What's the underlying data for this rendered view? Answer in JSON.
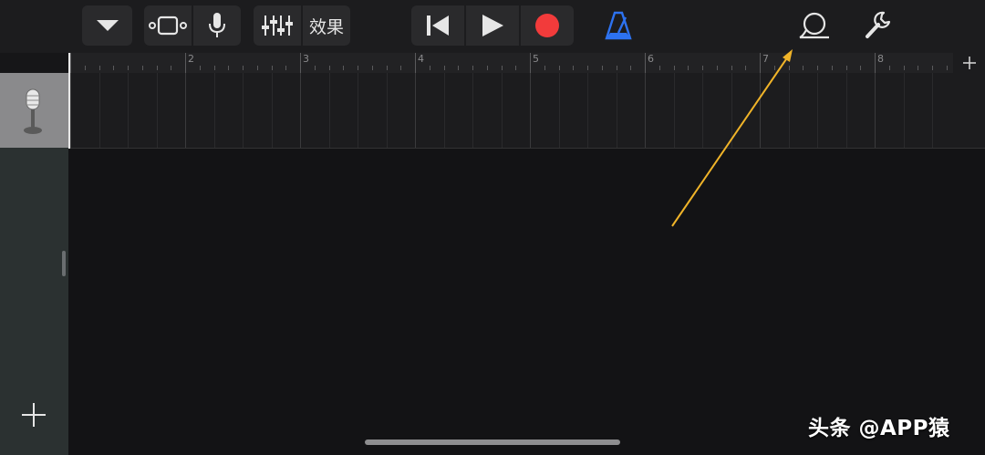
{
  "toolbar": {
    "dropdown_icon": "triangle-down-icon",
    "view_toggle_icon": "tracks-view-icon",
    "mic_icon": "microphone-icon",
    "mixer_icon": "mixer-sliders-icon",
    "effects_label": "效果",
    "rewind_icon": "go-to-beginning-icon",
    "play_icon": "play-icon",
    "record_icon": "record-icon",
    "metronome_icon": "metronome-icon",
    "loop_icon": "loop-browser-icon",
    "settings_icon": "wrench-icon"
  },
  "ruler": {
    "bars": [
      "2",
      "3",
      "4",
      "5",
      "6",
      "7",
      "8"
    ],
    "add_section_icon": "plus-icon"
  },
  "track": {
    "instrument_icon": "microphone-instrument-icon"
  },
  "sidebar": {
    "add_track_icon": "plus-icon"
  },
  "watermark": {
    "text": "头条 @APP猿"
  },
  "colors": {
    "record": "#f23b3b",
    "metronome": "#2d72f0",
    "annotation_arrow": "#f0b429",
    "background": "#131315",
    "toolbar": "#1c1c1e"
  }
}
